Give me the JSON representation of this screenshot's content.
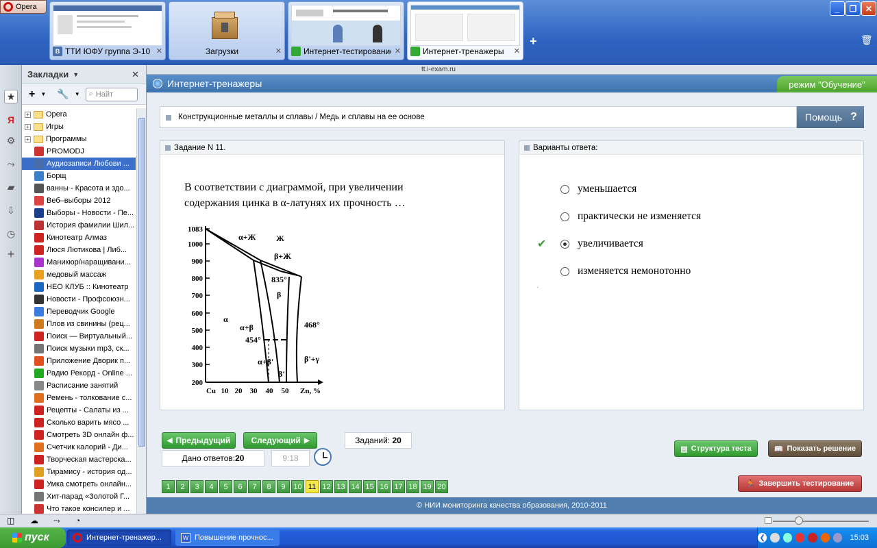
{
  "browser": {
    "menu_label": "Opera",
    "address": "tt.i-exam.ru",
    "tabs": [
      {
        "label": "ТТИ ЮФУ группа Э-10"
      },
      {
        "label": "Загрузки"
      },
      {
        "label": "Интернет-тестирование"
      },
      {
        "label": "Интернет-тренажеры"
      }
    ],
    "add_tab": "+"
  },
  "bookmarks": {
    "title": "Закладки",
    "search_placeholder": "Найт",
    "items": [
      {
        "label": "Opera",
        "kind": "folder",
        "color": "#ffe08a"
      },
      {
        "label": "Игры",
        "kind": "folder",
        "color": "#ffe08a"
      },
      {
        "label": "Программы",
        "kind": "folder",
        "color": "#ffe08a"
      },
      {
        "label": "PROMODJ",
        "kind": "link",
        "color": "#c33"
      },
      {
        "label": "Аудиозаписи Любови ...",
        "kind": "link",
        "color": "#4a6fa8"
      },
      {
        "label": "Борщ",
        "kind": "link",
        "color": "#3a7fc8"
      },
      {
        "label": "ванны - Красота и здо...",
        "kind": "link",
        "color": "#555"
      },
      {
        "label": "Веб–выборы 2012",
        "kind": "link",
        "color": "#d44"
      },
      {
        "label": "Выборы - Новости - Пе...",
        "kind": "link",
        "color": "#1b3e8c"
      },
      {
        "label": "История фамилии Шил...",
        "kind": "link",
        "color": "#b33"
      },
      {
        "label": "Кинотеатр Алмаз",
        "kind": "link",
        "color": "#c22"
      },
      {
        "label": "Люся Лютикова | Либ...",
        "kind": "link",
        "color": "#c22"
      },
      {
        "label": "Маникюр/наращивани...",
        "kind": "link",
        "color": "#a3c"
      },
      {
        "label": "медовый массаж",
        "kind": "link",
        "color": "#e9a020"
      },
      {
        "label": "НЕО КЛУБ :: Кинотеатр",
        "kind": "link",
        "color": "#1a66c0"
      },
      {
        "label": "Новости - Профсоюзн...",
        "kind": "link",
        "color": "#333"
      },
      {
        "label": "Переводчик Google",
        "kind": "link",
        "color": "#3b7de0"
      },
      {
        "label": "Плов из свинины (рец...",
        "kind": "link",
        "color": "#d07a20"
      },
      {
        "label": "Поиск — Виртуальный...",
        "kind": "link",
        "color": "#c22"
      },
      {
        "label": "Поиск музыки mp3, ск...",
        "kind": "link",
        "color": "#777"
      },
      {
        "label": "Приложение Дворик п...",
        "kind": "link",
        "color": "#e05020"
      },
      {
        "label": "Радио Рекорд - Online ...",
        "kind": "link",
        "color": "#2a2"
      },
      {
        "label": "Расписание занятий",
        "kind": "link",
        "color": "#888"
      },
      {
        "label": "Ремень - толкование с...",
        "kind": "link",
        "color": "#e07020"
      },
      {
        "label": "Рецепты - Салаты из ...",
        "kind": "link",
        "color": "#c22"
      },
      {
        "label": "Сколько варить мясо ...",
        "kind": "link",
        "color": "#c22"
      },
      {
        "label": "Смотреть 3D онлайн ф...",
        "kind": "link",
        "color": "#c22"
      },
      {
        "label": "Счетчик калорий - Ди...",
        "kind": "link",
        "color": "#e07020"
      },
      {
        "label": "Творческая мастерска...",
        "kind": "link",
        "color": "#c22"
      },
      {
        "label": "Тирамису - история од...",
        "kind": "link",
        "color": "#e0a020"
      },
      {
        "label": "Умка смотреть онлайн...",
        "kind": "link",
        "color": "#c22"
      },
      {
        "label": "Хит-парад «Золотой Г...",
        "kind": "link",
        "color": "#777"
      },
      {
        "label": "Что такое консилер и ...",
        "kind": "link",
        "color": "#c33"
      }
    ]
  },
  "app": {
    "title": "Интернет-тренажеры",
    "mode": "режим \"Обучение\"",
    "breadcrumb": "Конструкционные металлы и сплавы / Медь и сплавы на ее основе",
    "help": "Помощь",
    "task_header": "Задание N 11.",
    "question_line1": "В соответствии с диаграммой, при увеличении",
    "question_line2": "содержания цинка в α-латунях их прочность …",
    "answers_header": "Варианты ответа:",
    "answers": [
      {
        "label": "уменьшается",
        "selected": false
      },
      {
        "label": "практически не изменяется",
        "selected": false
      },
      {
        "label": "увеличивается",
        "selected": true
      },
      {
        "label": "изменяется немонотонно",
        "selected": false
      }
    ],
    "prev": "Предыдущий",
    "next": "Следующий",
    "tasks_label": "Заданий:",
    "tasks_count": "20",
    "answered_label": "Дано ответов:",
    "answered_count": "20",
    "timer": "9:18",
    "structure_btn": "Структура теста",
    "solution_btn": "Показать решение",
    "finish_btn": "Завершить тестирование",
    "pages": [
      "1",
      "2",
      "3",
      "4",
      "5",
      "6",
      "7",
      "8",
      "9",
      "10",
      "11",
      "12",
      "13",
      "14",
      "15",
      "16",
      "17",
      "18",
      "19",
      "20"
    ],
    "current_page": 11,
    "footer": "© НИИ мониторинга качества образования, 2010-2011"
  },
  "diagram": {
    "y_ticks": [
      "1083",
      "1000",
      "900",
      "800",
      "700",
      "600",
      "500",
      "400",
      "300",
      "200"
    ],
    "x_ticks": [
      "Cu",
      "10",
      "20",
      "30",
      "40",
      "50",
      "Zn, %"
    ],
    "labels": [
      "α+Ж",
      "Ж",
      "β+Ж",
      "835°",
      "β",
      "α",
      "α+β",
      "454°",
      "468°",
      "α+β'",
      "β'",
      "β'+γ"
    ]
  },
  "taskbar": {
    "start": "пуск",
    "tasks": [
      "Интернет-тренажер...",
      "Повышение прочнос..."
    ],
    "clock": "15:03"
  }
}
